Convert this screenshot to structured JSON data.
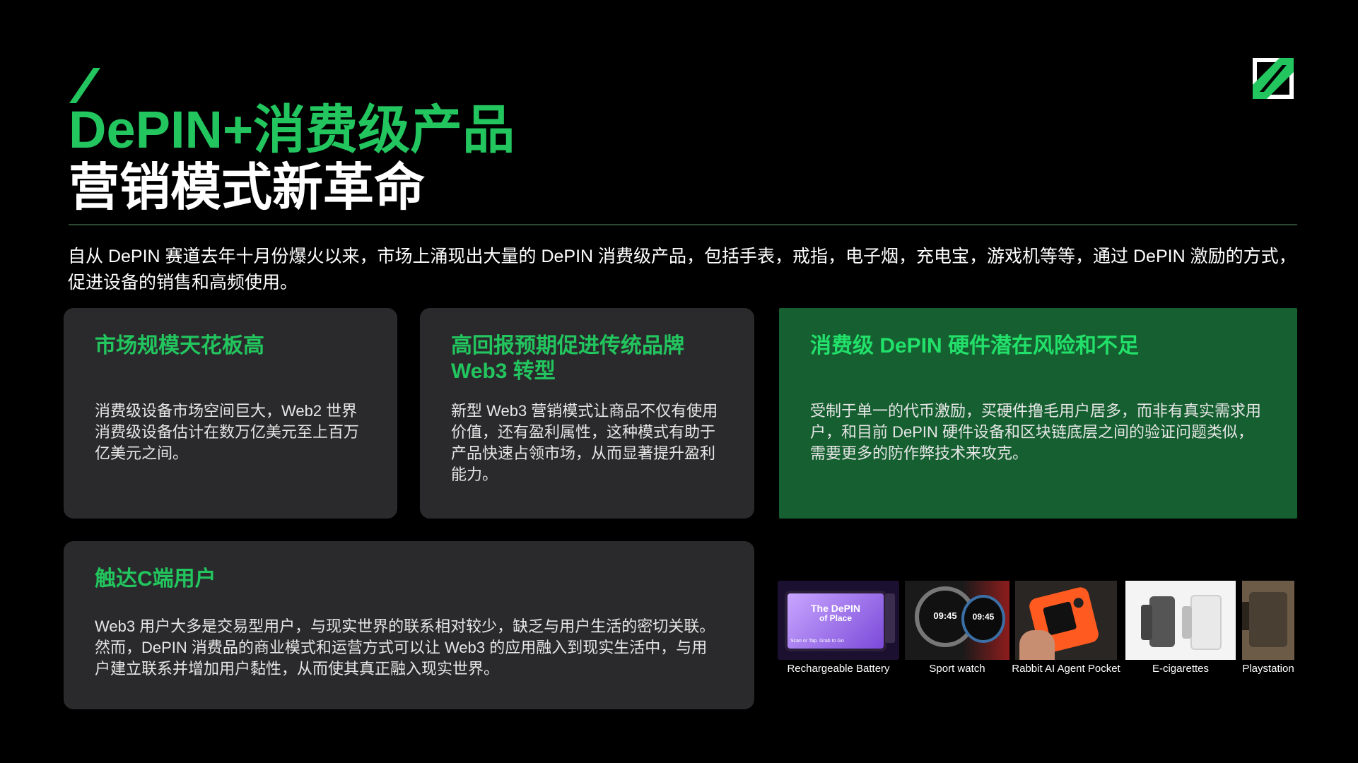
{
  "title": {
    "line1": "DePIN+消费级产品",
    "line2": "营销模式新革命"
  },
  "intro": "自从 DePIN 赛道去年十月份爆火以来，市场上涌现出大量的 DePIN 消费级产品，包括手表，戒指，电子烟，充电宝，游戏机等等，通过 DePIN 激励的方式，促进设备的销售和高频使用。",
  "cards": [
    {
      "title": "市场规模天花板高",
      "body": "消费级设备市场空间巨大，Web2 世界消费级设备估计在数万亿美元至上百万亿美元之间。"
    },
    {
      "title": "高回报预期促进传统品牌 Web3 转型",
      "body": "新型 Web3 营销模式让商品不仅有使用价值，还有盈利属性，这种模式有助于产品快速占领市场，从而显著提升盈利能力。"
    },
    {
      "title": "消费级 DePIN 硬件潜在风险和不足",
      "body": "受制于单一的代币激励，买硬件撸毛用户居多，而非有真实需求用户，和目前 DePIN 硬件设备和区块链底层之间的验证问题类似，需要更多的防作弊技术来攻克。"
    },
    {
      "title": "触达C端用户",
      "body": "Web3 用户大多是交易型用户，与现实世界的联系相对较少，缺乏与用户生活的密切关联。然而，DePIN 消费品的商业模式和运营方式可以让 Web3 的应用融入到现实生活中，与用户建立联系并增加用户黏性，从而使其真正融入现实世界。"
    }
  ],
  "gallery": [
    {
      "caption": "Rechargeable Battery",
      "screen_line1": "The DePIN",
      "screen_line2": "of Place",
      "screen_small": "Scan or Tap. Grab to Go"
    },
    {
      "caption": "Sport watch",
      "time_left": "09:45",
      "time_right": "09:45"
    },
    {
      "caption": "Rabbit AI Agent Pocket"
    },
    {
      "caption": "E-cigarettes"
    },
    {
      "caption": "Playstation"
    }
  ],
  "colors": {
    "accent": "#22c55e",
    "card_bg": "#2a2a2c",
    "card_green_bg": "#155f30"
  }
}
